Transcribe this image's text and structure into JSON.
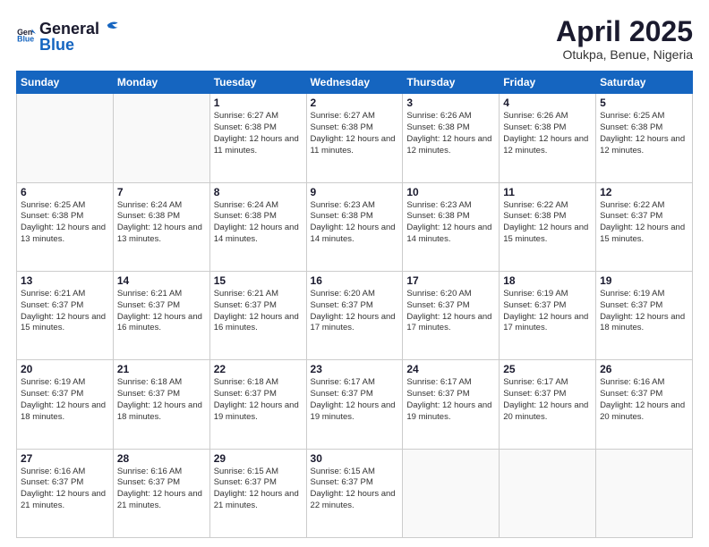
{
  "header": {
    "logo_general": "General",
    "logo_blue": "Blue",
    "title": "April 2025",
    "subtitle": "Otukpa, Benue, Nigeria"
  },
  "days_of_week": [
    "Sunday",
    "Monday",
    "Tuesday",
    "Wednesday",
    "Thursday",
    "Friday",
    "Saturday"
  ],
  "weeks": [
    [
      {
        "day": "",
        "info": ""
      },
      {
        "day": "",
        "info": ""
      },
      {
        "day": "1",
        "info": "Sunrise: 6:27 AM\nSunset: 6:38 PM\nDaylight: 12 hours and 11 minutes."
      },
      {
        "day": "2",
        "info": "Sunrise: 6:27 AM\nSunset: 6:38 PM\nDaylight: 12 hours and 11 minutes."
      },
      {
        "day": "3",
        "info": "Sunrise: 6:26 AM\nSunset: 6:38 PM\nDaylight: 12 hours and 12 minutes."
      },
      {
        "day": "4",
        "info": "Sunrise: 6:26 AM\nSunset: 6:38 PM\nDaylight: 12 hours and 12 minutes."
      },
      {
        "day": "5",
        "info": "Sunrise: 6:25 AM\nSunset: 6:38 PM\nDaylight: 12 hours and 12 minutes."
      }
    ],
    [
      {
        "day": "6",
        "info": "Sunrise: 6:25 AM\nSunset: 6:38 PM\nDaylight: 12 hours and 13 minutes."
      },
      {
        "day": "7",
        "info": "Sunrise: 6:24 AM\nSunset: 6:38 PM\nDaylight: 12 hours and 13 minutes."
      },
      {
        "day": "8",
        "info": "Sunrise: 6:24 AM\nSunset: 6:38 PM\nDaylight: 12 hours and 14 minutes."
      },
      {
        "day": "9",
        "info": "Sunrise: 6:23 AM\nSunset: 6:38 PM\nDaylight: 12 hours and 14 minutes."
      },
      {
        "day": "10",
        "info": "Sunrise: 6:23 AM\nSunset: 6:38 PM\nDaylight: 12 hours and 14 minutes."
      },
      {
        "day": "11",
        "info": "Sunrise: 6:22 AM\nSunset: 6:38 PM\nDaylight: 12 hours and 15 minutes."
      },
      {
        "day": "12",
        "info": "Sunrise: 6:22 AM\nSunset: 6:37 PM\nDaylight: 12 hours and 15 minutes."
      }
    ],
    [
      {
        "day": "13",
        "info": "Sunrise: 6:21 AM\nSunset: 6:37 PM\nDaylight: 12 hours and 15 minutes."
      },
      {
        "day": "14",
        "info": "Sunrise: 6:21 AM\nSunset: 6:37 PM\nDaylight: 12 hours and 16 minutes."
      },
      {
        "day": "15",
        "info": "Sunrise: 6:21 AM\nSunset: 6:37 PM\nDaylight: 12 hours and 16 minutes."
      },
      {
        "day": "16",
        "info": "Sunrise: 6:20 AM\nSunset: 6:37 PM\nDaylight: 12 hours and 17 minutes."
      },
      {
        "day": "17",
        "info": "Sunrise: 6:20 AM\nSunset: 6:37 PM\nDaylight: 12 hours and 17 minutes."
      },
      {
        "day": "18",
        "info": "Sunrise: 6:19 AM\nSunset: 6:37 PM\nDaylight: 12 hours and 17 minutes."
      },
      {
        "day": "19",
        "info": "Sunrise: 6:19 AM\nSunset: 6:37 PM\nDaylight: 12 hours and 18 minutes."
      }
    ],
    [
      {
        "day": "20",
        "info": "Sunrise: 6:19 AM\nSunset: 6:37 PM\nDaylight: 12 hours and 18 minutes."
      },
      {
        "day": "21",
        "info": "Sunrise: 6:18 AM\nSunset: 6:37 PM\nDaylight: 12 hours and 18 minutes."
      },
      {
        "day": "22",
        "info": "Sunrise: 6:18 AM\nSunset: 6:37 PM\nDaylight: 12 hours and 19 minutes."
      },
      {
        "day": "23",
        "info": "Sunrise: 6:17 AM\nSunset: 6:37 PM\nDaylight: 12 hours and 19 minutes."
      },
      {
        "day": "24",
        "info": "Sunrise: 6:17 AM\nSunset: 6:37 PM\nDaylight: 12 hours and 19 minutes."
      },
      {
        "day": "25",
        "info": "Sunrise: 6:17 AM\nSunset: 6:37 PM\nDaylight: 12 hours and 20 minutes."
      },
      {
        "day": "26",
        "info": "Sunrise: 6:16 AM\nSunset: 6:37 PM\nDaylight: 12 hours and 20 minutes."
      }
    ],
    [
      {
        "day": "27",
        "info": "Sunrise: 6:16 AM\nSunset: 6:37 PM\nDaylight: 12 hours and 21 minutes."
      },
      {
        "day": "28",
        "info": "Sunrise: 6:16 AM\nSunset: 6:37 PM\nDaylight: 12 hours and 21 minutes."
      },
      {
        "day": "29",
        "info": "Sunrise: 6:15 AM\nSunset: 6:37 PM\nDaylight: 12 hours and 21 minutes."
      },
      {
        "day": "30",
        "info": "Sunrise: 6:15 AM\nSunset: 6:37 PM\nDaylight: 12 hours and 22 minutes."
      },
      {
        "day": "",
        "info": ""
      },
      {
        "day": "",
        "info": ""
      },
      {
        "day": "",
        "info": ""
      }
    ]
  ]
}
